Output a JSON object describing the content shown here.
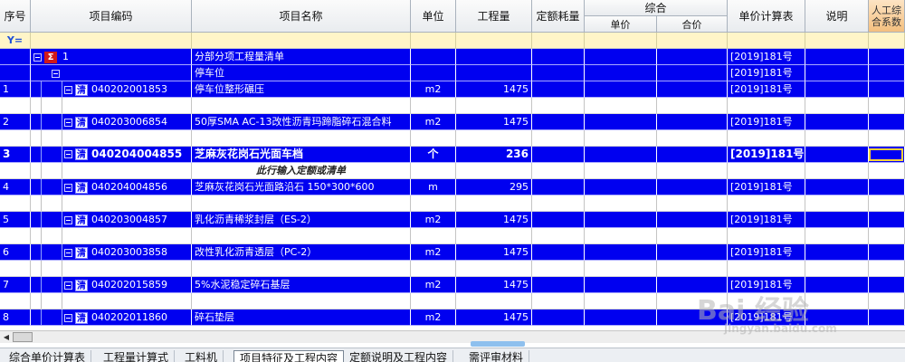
{
  "headers": {
    "seq": "序号",
    "code": "项目编码",
    "name": "项目名称",
    "unit": "单位",
    "qty": "工程量",
    "quota_consumption": "定额耗量",
    "combined": "综合",
    "unit_price": "单价",
    "total_price": "合价",
    "unit_calc_table": "单价计算表",
    "description": "说明",
    "labor_coef": "人工综合系数"
  },
  "filter": {
    "icon": "filter-icon",
    "glyph": "Y="
  },
  "rows": [
    {
      "type": "group",
      "seq": "",
      "code": "1",
      "name": "分部分项工程量清单",
      "unit": "",
      "qty": "",
      "calc": "[2019]181号"
    },
    {
      "type": "subgroup",
      "seq": "",
      "code": "",
      "name": "停车位",
      "unit": "",
      "qty": "",
      "calc": "[2019]181号"
    },
    {
      "type": "item",
      "seq": "1",
      "code": "040202001853",
      "name": "停车位整形碾压",
      "unit": "m2",
      "qty": "1475",
      "calc": "[2019]181号",
      "badge": "清"
    },
    {
      "type": "blank"
    },
    {
      "type": "item",
      "seq": "2",
      "code": "040203006854",
      "name": "50厚SMA AC-13改性沥青玛蹄脂碎石混合料",
      "unit": "m2",
      "qty": "1475",
      "calc": "[2019]181号",
      "badge": "清"
    },
    {
      "type": "blank"
    },
    {
      "type": "item-bold",
      "seq": "3",
      "code": "040204004855",
      "name": "芝麻灰花岗石光面车档",
      "unit": "个",
      "qty": "236",
      "calc": "[2019]181号",
      "badge": "清"
    },
    {
      "type": "hint",
      "text": "此行输入定额或清单"
    },
    {
      "type": "item",
      "seq": "4",
      "code": "040204004856",
      "name": "芝麻灰花岗石光面路沿石 150*300*600",
      "unit": "m",
      "qty": "295",
      "calc": "[2019]181号",
      "badge": "清"
    },
    {
      "type": "blank"
    },
    {
      "type": "item",
      "seq": "5",
      "code": "040203004857",
      "name": "乳化沥青稀浆封层（ES-2）",
      "unit": "m2",
      "qty": "1475",
      "calc": "[2019]181号",
      "badge": "清"
    },
    {
      "type": "blank"
    },
    {
      "type": "item",
      "seq": "6",
      "code": "040203003858",
      "name": "改性乳化沥青透层（PC-2）",
      "unit": "m2",
      "qty": "1475",
      "calc": "[2019]181号",
      "badge": "清"
    },
    {
      "type": "blank"
    },
    {
      "type": "item",
      "seq": "7",
      "code": "040202015859",
      "name": "5%水泥稳定碎石基层",
      "unit": "m2",
      "qty": "1475",
      "calc": "[2019]181号",
      "badge": "清"
    },
    {
      "type": "blank"
    },
    {
      "type": "item",
      "seq": "8",
      "code": "040202011860",
      "name": "碎石垫层",
      "unit": "m2",
      "qty": "1475",
      "calc": "[2019]181号",
      "badge": "清"
    }
  ],
  "tabs": [
    {
      "label": "综合单价计算表",
      "active": false
    },
    {
      "label": "工程量计算式",
      "active": false
    },
    {
      "label": "工料机",
      "active": false
    },
    {
      "label": "项目特征及工程内容",
      "active": true
    },
    {
      "label": "定额说明及工程内容",
      "active": false
    },
    {
      "label": "需评审材料",
      "active": false
    }
  ],
  "watermark": {
    "brand": "Bai 经验",
    "url": "jingyan.baidu.com"
  },
  "colors": {
    "row_highlight": "#0000f0",
    "header_bg": "#e9ecef",
    "filter_bg": "#fff5c8",
    "labor_header": "#f4bf7e"
  }
}
